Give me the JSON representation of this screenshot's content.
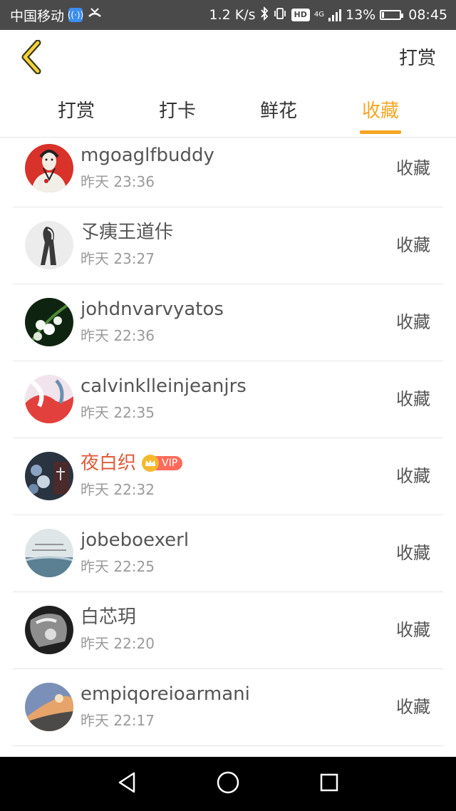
{
  "status_bar": {
    "carrier": "中国移动",
    "network_speed": "1.2 K/s",
    "network_type": "4G",
    "battery": "13%",
    "battery_level": 0.13,
    "time": "08:45",
    "icons": [
      "wifi-call-icon",
      "missed-call-icon",
      "bluetooth-icon",
      "vibrate-icon",
      "hd-icon",
      "signal-icon",
      "battery-icon"
    ]
  },
  "header": {
    "back_icon": "chevron-left-icon",
    "action_label": "打赏",
    "accent_color": "#f5a623"
  },
  "tabs": [
    {
      "label": "打赏",
      "active": false
    },
    {
      "label": "打卡",
      "active": false
    },
    {
      "label": "鲜花",
      "active": false
    },
    {
      "label": "收藏",
      "active": true
    }
  ],
  "list": {
    "items": [
      {
        "name": "mgoaglfbuddy",
        "time": "昨天 23:36",
        "action": "收藏",
        "vip": false
      },
      {
        "name": "孓痍王道佧",
        "time": "昨天 23:27",
        "action": "收藏",
        "vip": false
      },
      {
        "name": "johdnvarvyatos",
        "time": "昨天 22:36",
        "action": "收藏",
        "vip": false
      },
      {
        "name": "calvinklleinjeanjrs",
        "time": "昨天 22:35",
        "action": "收藏",
        "vip": false
      },
      {
        "name": "夜白织",
        "time": "昨天 22:32",
        "action": "收藏",
        "vip": true,
        "vip_label": "VIP"
      },
      {
        "name": "jobeboexerl",
        "time": "昨天 22:25",
        "action": "收藏",
        "vip": false
      },
      {
        "name": "白芯玥",
        "time": "昨天 22:20",
        "action": "收藏",
        "vip": false
      },
      {
        "name": "empiqoreioarmani",
        "time": "昨天 22:17",
        "action": "收藏",
        "vip": false
      }
    ]
  },
  "nav_bar": {
    "buttons": [
      "back-triangle-icon",
      "home-circle-icon",
      "recents-square-icon"
    ]
  }
}
